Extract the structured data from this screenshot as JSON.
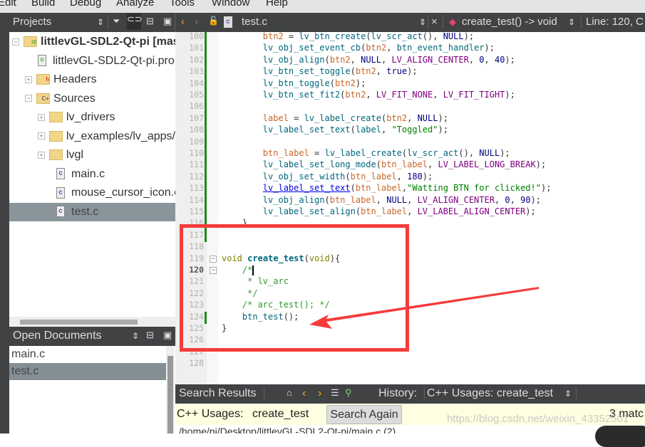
{
  "menu": [
    "Edit",
    "Build",
    "Debug",
    "Analyze",
    "Tools",
    "Window",
    "Help"
  ],
  "projects_pane": {
    "title": "Projects",
    "tree": [
      {
        "label": "littlevGL-SDL2-Qt-pi [mas",
        "bold": true,
        "icon": "qt-project-folder-icon",
        "expander": "−",
        "indent": 0
      },
      {
        "label": "littlevGL-SDL2-Qt-pi.pro",
        "icon": "pro-file-icon",
        "indent": 1
      },
      {
        "label": "Headers",
        "icon": "headers-folder-icon",
        "expander": "+",
        "indent": 1
      },
      {
        "label": "Sources",
        "icon": "sources-folder-icon",
        "expander": "−",
        "indent": 1
      },
      {
        "label": "lv_drivers",
        "icon": "folder-icon",
        "expander": "+",
        "indent": 2
      },
      {
        "label": "lv_examples/lv_apps/",
        "icon": "folder-icon",
        "expander": "+",
        "indent": 2
      },
      {
        "label": "lvgl",
        "icon": "folder-icon",
        "expander": "+",
        "indent": 2
      },
      {
        "label": "main.c",
        "icon": "c-file-icon",
        "indent": 3
      },
      {
        "label": "mouse_cursor_icon.c",
        "icon": "c-file-icon",
        "indent": 3
      },
      {
        "label": "test.c",
        "icon": "c-file-icon",
        "indent": 3,
        "selected": true
      }
    ]
  },
  "open_documents": {
    "title": "Open Documents",
    "items": [
      {
        "label": "main.c"
      },
      {
        "label": "test.c",
        "selected": true
      }
    ]
  },
  "editor": {
    "file": "test.c",
    "symbol": "create_test() -> void",
    "position": "Line: 120, C",
    "current_line": 120,
    "lines": [
      {
        "n": 100,
        "chg": 1,
        "t": [
          [
            "p",
            "        "
          ],
          [
            "v",
            "btn2"
          ],
          [
            "p",
            " = "
          ],
          [
            "f",
            "lv_btn_create"
          ],
          [
            "p",
            "("
          ],
          [
            "f",
            "lv_scr_act"
          ],
          [
            "p",
            "(), "
          ],
          [
            "m",
            "NULL"
          ],
          [
            "p",
            ");"
          ]
        ]
      },
      {
        "n": 101,
        "chg": 1,
        "t": [
          [
            "p",
            "        "
          ],
          [
            "f",
            "lv_obj_set_event_cb"
          ],
          [
            "p",
            "("
          ],
          [
            "v",
            "btn2"
          ],
          [
            "p",
            ", "
          ],
          [
            "f",
            "btn_event_handler"
          ],
          [
            "p",
            ");"
          ]
        ]
      },
      {
        "n": 102,
        "chg": 1,
        "t": [
          [
            "p",
            "        "
          ],
          [
            "f",
            "lv_obj_align"
          ],
          [
            "p",
            "("
          ],
          [
            "v",
            "btn2"
          ],
          [
            "p",
            ", "
          ],
          [
            "m",
            "NULL"
          ],
          [
            "p",
            ", "
          ],
          [
            "e",
            "LV_ALIGN_CENTER"
          ],
          [
            "p",
            ", "
          ],
          [
            "n",
            "0"
          ],
          [
            "p",
            ", "
          ],
          [
            "n",
            "40"
          ],
          [
            "p",
            ");"
          ]
        ]
      },
      {
        "n": 103,
        "chg": 1,
        "t": [
          [
            "p",
            "        "
          ],
          [
            "f",
            "lv_btn_set_toggle"
          ],
          [
            "p",
            "("
          ],
          [
            "v",
            "btn2"
          ],
          [
            "p",
            ", "
          ],
          [
            "m",
            "true"
          ],
          [
            "p",
            ");"
          ]
        ]
      },
      {
        "n": 104,
        "chg": 1,
        "t": [
          [
            "p",
            "        "
          ],
          [
            "f",
            "lv_btn_toggle"
          ],
          [
            "p",
            "("
          ],
          [
            "v",
            "btn2"
          ],
          [
            "p",
            ");"
          ]
        ]
      },
      {
        "n": 105,
        "chg": 1,
        "t": [
          [
            "p",
            "        "
          ],
          [
            "f",
            "lv_btn_set_fit2"
          ],
          [
            "p",
            "("
          ],
          [
            "v",
            "btn2"
          ],
          [
            "p",
            ", "
          ],
          [
            "e",
            "LV_FIT_NONE"
          ],
          [
            "p",
            ", "
          ],
          [
            "e",
            "LV_FIT_TIGHT"
          ],
          [
            "p",
            ");"
          ]
        ]
      },
      {
        "n": 106,
        "chg": 1,
        "t": []
      },
      {
        "n": 107,
        "chg": 1,
        "t": [
          [
            "p",
            "        "
          ],
          [
            "v",
            "label"
          ],
          [
            "p",
            " = "
          ],
          [
            "f",
            "lv_label_create"
          ],
          [
            "p",
            "("
          ],
          [
            "v",
            "btn2"
          ],
          [
            "p",
            ", "
          ],
          [
            "m",
            "NULL"
          ],
          [
            "p",
            ");"
          ]
        ]
      },
      {
        "n": 108,
        "chg": 1,
        "t": [
          [
            "p",
            "        "
          ],
          [
            "f",
            "lv_label_set_text"
          ],
          [
            "p",
            "("
          ],
          [
            "f",
            "label"
          ],
          [
            "p",
            ", "
          ],
          [
            "s",
            "\"Toggled\""
          ],
          [
            "p",
            ");"
          ]
        ]
      },
      {
        "n": 109,
        "chg": 1,
        "t": []
      },
      {
        "n": 110,
        "chg": 1,
        "t": [
          [
            "p",
            "        "
          ],
          [
            "v",
            "btn_label"
          ],
          [
            "p",
            " = "
          ],
          [
            "f",
            "lv_label_create"
          ],
          [
            "p",
            "("
          ],
          [
            "f",
            "lv_scr_act"
          ],
          [
            "p",
            "(), "
          ],
          [
            "m",
            "NULL"
          ],
          [
            "p",
            ");"
          ]
        ]
      },
      {
        "n": 111,
        "chg": 1,
        "t": [
          [
            "p",
            "        "
          ],
          [
            "f",
            "lv_label_set_long_mode"
          ],
          [
            "p",
            "("
          ],
          [
            "v",
            "btn_label"
          ],
          [
            "p",
            ", "
          ],
          [
            "e",
            "LV_LABEL_LONG_BREAK"
          ],
          [
            "p",
            ");"
          ]
        ]
      },
      {
        "n": 112,
        "chg": 1,
        "t": [
          [
            "p",
            "        "
          ],
          [
            "f",
            "lv_obj_set_width"
          ],
          [
            "p",
            "("
          ],
          [
            "v",
            "btn_label"
          ],
          [
            "p",
            ", "
          ],
          [
            "n",
            "180"
          ],
          [
            "p",
            ");"
          ]
        ]
      },
      {
        "n": 113,
        "chg": 1,
        "t": [
          [
            "p",
            "        "
          ],
          [
            "u",
            "lv_label_set_text"
          ],
          [
            "p",
            "("
          ],
          [
            "v",
            "btn_label"
          ],
          [
            "p",
            ","
          ],
          [
            "s",
            "\"Watting BTN for clicked!\""
          ],
          [
            "p",
            ");"
          ]
        ]
      },
      {
        "n": 114,
        "chg": 1,
        "t": [
          [
            "p",
            "        "
          ],
          [
            "f",
            "lv_obj_align"
          ],
          [
            "p",
            "("
          ],
          [
            "v",
            "btn_label"
          ],
          [
            "p",
            ", "
          ],
          [
            "m",
            "NULL"
          ],
          [
            "p",
            ", "
          ],
          [
            "e",
            "LV_ALIGN_CENTER"
          ],
          [
            "p",
            ", "
          ],
          [
            "n",
            "0"
          ],
          [
            "p",
            ", "
          ],
          [
            "n",
            "90"
          ],
          [
            "p",
            ");"
          ]
        ]
      },
      {
        "n": 115,
        "chg": 1,
        "t": [
          [
            "p",
            "        "
          ],
          [
            "f",
            "lv_label_set_align"
          ],
          [
            "p",
            "("
          ],
          [
            "v",
            "btn_label"
          ],
          [
            "p",
            ", "
          ],
          [
            "e",
            "LV_LABEL_ALIGN_CENTER"
          ],
          [
            "p",
            ");"
          ]
        ]
      },
      {
        "n": 116,
        "chg": 1,
        "t": [
          [
            "p",
            "    }"
          ]
        ]
      },
      {
        "n": 117,
        "chg": 1,
        "t": []
      },
      {
        "n": 118,
        "t": []
      },
      {
        "n": 119,
        "fold": 1,
        "t": [
          [
            "k",
            "void"
          ],
          [
            "p",
            " "
          ],
          [
            "fb",
            "create_test"
          ],
          [
            "p",
            "("
          ],
          [
            "k",
            "void"
          ],
          [
            "p",
            "){"
          ]
        ]
      },
      {
        "n": 120,
        "fold": 1,
        "t": [
          [
            "p",
            "    "
          ],
          [
            "c",
            "/*"
          ]
        ]
      },
      {
        "n": 121,
        "t": [
          [
            "c",
            "     * lv_arc"
          ]
        ]
      },
      {
        "n": 122,
        "t": [
          [
            "c",
            "     */"
          ]
        ]
      },
      {
        "n": 123,
        "t": [
          [
            "p",
            "    "
          ],
          [
            "c",
            "/* arc_test(); */"
          ]
        ]
      },
      {
        "n": 124,
        "chg": 1,
        "t": [
          [
            "p",
            "    "
          ],
          [
            "f",
            "btn_test"
          ],
          [
            "p",
            "();"
          ]
        ]
      },
      {
        "n": 125,
        "t": [
          [
            "p",
            "}"
          ]
        ]
      },
      {
        "n": 126,
        "t": []
      },
      {
        "n": 127,
        "t": []
      },
      {
        "n": 128,
        "t": []
      }
    ]
  },
  "search_results": {
    "title": "Search Results",
    "history_label": "History:",
    "history_value": "C++ Usages: create_test",
    "kind": "C++ Usages:",
    "term": "create_test",
    "search_again": "Search Again",
    "matches": "3 matc",
    "first_row": "/home/pi/Desktop/littlevGL-SDL2-Qt-pi/main.c (2)"
  },
  "watermark": "https://blog.csdn.net/weixin_43352501",
  "annotation_color": "#f53b3b"
}
